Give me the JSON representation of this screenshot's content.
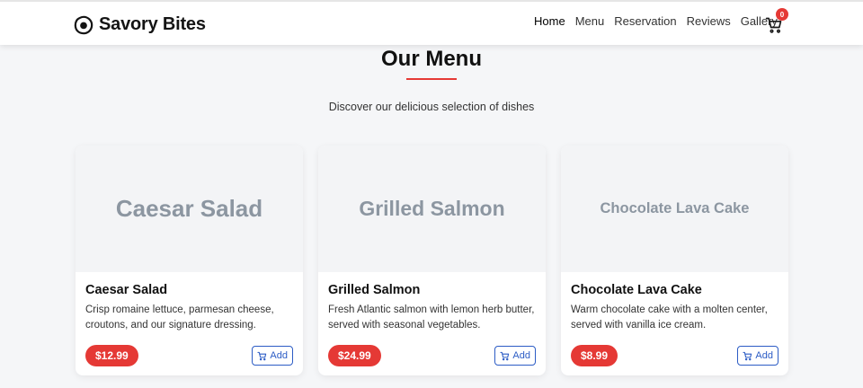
{
  "brand": {
    "name": "Savory Bites",
    "icon": "egg-icon"
  },
  "nav": {
    "items": [
      {
        "label": "Home",
        "active": true
      },
      {
        "label": "Menu",
        "active": false
      },
      {
        "label": "Reservation",
        "active": false
      },
      {
        "label": "Reviews",
        "active": false
      },
      {
        "label": "Gallery",
        "active": false
      }
    ],
    "cart_count": "0",
    "cart_icon": "cart-icon"
  },
  "menu": {
    "title": "Our Menu",
    "subtitle": "Discover our delicious selection of dishes",
    "items": [
      {
        "image_text": "Caesar Salad",
        "name": "Caesar Salad",
        "description": "Crisp romaine lettuce, parmesan cheese, croutons, and our signature dressing.",
        "price": "$12.99",
        "add_label": "Add"
      },
      {
        "image_text": "Grilled Salmon",
        "name": "Grilled Salmon",
        "description": "Fresh Atlantic salmon with lemon herb butter, served with seasonal vegetables.",
        "price": "$24.99",
        "add_label": "Add"
      },
      {
        "image_text": "Chocolate Lava Cake",
        "name": "Chocolate Lava Cake",
        "description": "Warm chocolate cake with a molten center, served with vanilla ice cream.",
        "price": "$8.99",
        "add_label": "Add"
      }
    ]
  },
  "colors": {
    "accent": "#e53935",
    "button": "#2c5cc5",
    "placeholder_text": "#8c96a1"
  }
}
